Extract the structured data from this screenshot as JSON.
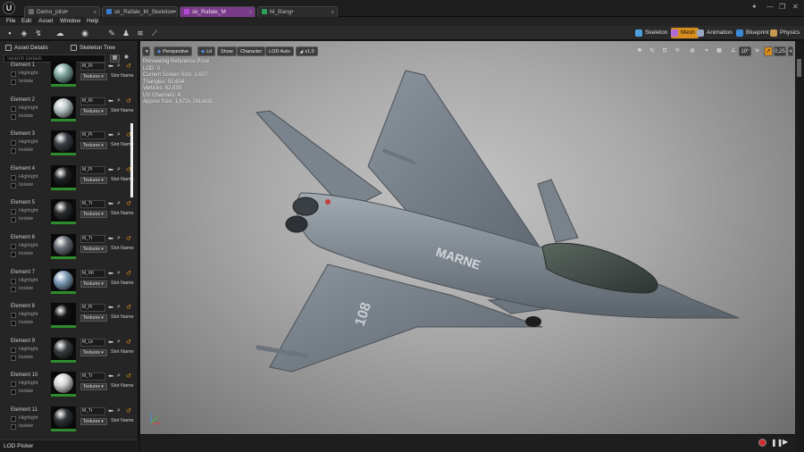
{
  "tabs": [
    {
      "label": "Demo_pilot•",
      "color": "#6c6c6c"
    },
    {
      "label": "sk_Rafale_M_Skeleton•",
      "color": "#3a7acf"
    },
    {
      "label": "sk_Rafale_M",
      "color": "#b24bd6"
    },
    {
      "label": "M_Bang•",
      "color": "#2f9c59"
    }
  ],
  "window_controls": {
    "minimize": "—",
    "maximize": "❐",
    "close": "✕"
  },
  "menu": [
    "File",
    "Edit",
    "Asset",
    "Window",
    "Help"
  ],
  "modes": [
    {
      "label": "Skeleton",
      "color": "#4da0e0"
    },
    {
      "label": "Mesh",
      "color": "#b06bd8"
    },
    {
      "label": "Animation",
      "color": "#9aa7c2"
    },
    {
      "label": "Blueprint",
      "color": "#3a8ad8"
    },
    {
      "label": "Physics",
      "color": "#c59a50"
    }
  ],
  "left_panel": {
    "tab_asset_details": "Asset Details",
    "tab_skeleton_tree": "Skeleton Tree",
    "search_placeholder": "Search Details",
    "highlight_label": "Highlight",
    "isolate_label": "Isolate",
    "textures_label": "Textures",
    "slot_name_label": "Slot Name",
    "elements": [
      {
        "name": "Element 1",
        "material": "M_Ri",
        "sphere": "#7fa8a0"
      },
      {
        "name": "Element 2",
        "material": "M_Ri",
        "sphere": "#b8c4c4"
      },
      {
        "name": "Element 3",
        "material": "M_Pi",
        "sphere": "#3b4046"
      },
      {
        "name": "Element 4",
        "material": "M_Pi",
        "sphere": "#1e2022"
      },
      {
        "name": "Element 5",
        "material": "M_Tr",
        "sphere": "#2a2c2e"
      },
      {
        "name": "Element 6",
        "material": "M_Tr",
        "sphere": "#6a7078"
      },
      {
        "name": "Element 7",
        "material": "M_Wi",
        "sphere": "#7f9cb8"
      },
      {
        "name": "Element 8",
        "material": "M_Pi",
        "sphere": "#141414"
      },
      {
        "name": "Element 9",
        "material": "M_Ur",
        "sphere": "#3a3d40"
      },
      {
        "name": "Element 10",
        "material": "M_Tr",
        "sphere": "#d4d4d4"
      },
      {
        "name": "Element 11",
        "material": "M_Tr",
        "sphere": "#303336"
      }
    ],
    "lod_picker": "LOD Picker"
  },
  "viewport": {
    "perspective": "Perspective",
    "lit": "Lit",
    "show": "Show",
    "character": "Character",
    "lod_auto": "LOD Auto",
    "speed": "x1,0",
    "snap_angle": "10°",
    "scale_value": "0,25",
    "camera_speed": "4",
    "stats": [
      "Previewing Reference Pose",
      "LOD: 0",
      "Current Screen Size: 1,607",
      "Triangles: 92,604",
      "Vertices: 82,839",
      "UV Channels: 4",
      "Approx Size: 1,672x 741x631"
    ],
    "plane_marking": "MARNE",
    "plane_number": "108"
  }
}
